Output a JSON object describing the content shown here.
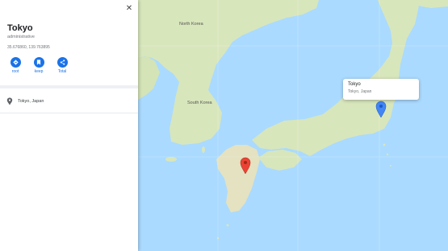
{
  "panel": {
    "title": "Tokyo",
    "type": "administrative",
    "coords": "35.676860, 139.763895",
    "actions": [
      {
        "label": "root",
        "icon": "directions-icon"
      },
      {
        "label": "keep",
        "icon": "bookmark-icon"
      },
      {
        "label": "Total",
        "icon": "share-icon"
      }
    ],
    "address": "Tokyo, Japan"
  },
  "map": {
    "labels": {
      "north_korea": "North Korea",
      "south_korea": "South Korea"
    },
    "popup": {
      "title": "Tokyo",
      "subtitle": "Tokyo, Japan"
    },
    "colors": {
      "water": "#aadaff",
      "land": "#d8e8c0",
      "land_alt": "#e8e4c8",
      "marker_blue": "#4285f4",
      "marker_red": "#ea4335",
      "accent": "#1a73e8"
    }
  }
}
